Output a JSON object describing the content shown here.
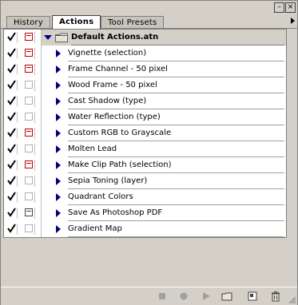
{
  "window": {
    "minimize_glyph": "–",
    "close_glyph": "×"
  },
  "tabs": [
    {
      "label": "History",
      "active": false
    },
    {
      "label": "Actions",
      "active": true
    },
    {
      "label": "Tool Presets",
      "active": false
    }
  ],
  "action_set": {
    "name": "Default Actions.atn",
    "checked": true,
    "dialog": "red",
    "expanded": true
  },
  "actions": [
    {
      "name": "Vignette (selection)",
      "checked": true,
      "dialog": "red"
    },
    {
      "name": "Frame Channel - 50 pixel",
      "checked": true,
      "dialog": "red"
    },
    {
      "name": "Wood Frame - 50 pixel",
      "checked": true,
      "dialog": "none"
    },
    {
      "name": "Cast Shadow (type)",
      "checked": true,
      "dialog": "none"
    },
    {
      "name": "Water Reflection (type)",
      "checked": true,
      "dialog": "none"
    },
    {
      "name": "Custom RGB to Grayscale",
      "checked": true,
      "dialog": "red"
    },
    {
      "name": "Molten Lead",
      "checked": true,
      "dialog": "none"
    },
    {
      "name": "Make Clip Path (selection)",
      "checked": true,
      "dialog": "red"
    },
    {
      "name": "Sepia Toning (layer)",
      "checked": true,
      "dialog": "none"
    },
    {
      "name": "Quadrant Colors",
      "checked": true,
      "dialog": "none"
    },
    {
      "name": "Save As Photoshop PDF",
      "checked": true,
      "dialog": "dark"
    },
    {
      "name": "Gradient Map",
      "checked": true,
      "dialog": "none"
    }
  ],
  "bottom_buttons": [
    "stop-icon",
    "record-icon",
    "play-icon",
    "new-set-icon",
    "new-action-icon",
    "trash-icon"
  ],
  "colors": {
    "accent_triangle": "#000080",
    "dialog_red": "#c00000"
  }
}
